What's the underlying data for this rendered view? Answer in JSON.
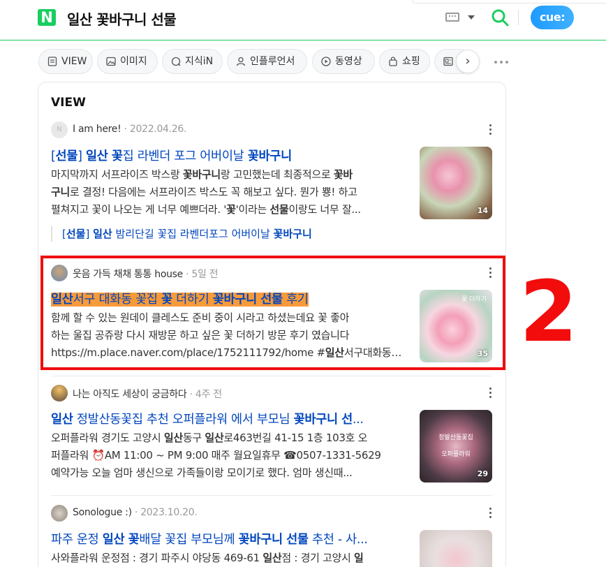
{
  "header": {
    "logo": "N",
    "query": "일산 꽃바구니 선물",
    "cue_label": "cue:"
  },
  "tabs": [
    {
      "label": "VIEW",
      "icon": "document-icon"
    },
    {
      "label": "이미지",
      "icon": "image-icon"
    },
    {
      "label": "지식iN",
      "icon": "question-icon"
    },
    {
      "label": "인플루언서",
      "icon": "person-icon"
    },
    {
      "label": "동영상",
      "icon": "play-icon"
    },
    {
      "label": "쇼핑",
      "icon": "bag-icon"
    },
    {
      "label": "",
      "icon": "news-icon"
    }
  ],
  "section_title": "VIEW",
  "results": [
    {
      "author": "I am here!",
      "date": "2022.04.26.",
      "title": "[선물] 일산 꽃집 라벤더 포그 어버이날 꽃바구니",
      "desc": [
        "마지막까지 서프라이즈 박스랑 꽃바구니랑 고민했는데 최종적으로 꽃바",
        "구니로 결정! 다음에는 서프라이즈 박스도 꼭 해보고 싶다. 뭔가 뿅! 하고",
        "펼쳐지고 꽃이 나오는 게 너무 예쁘더라. '꽃'이라는 선물이랑도 너무 잘..."
      ],
      "sub_link": "[선물] 일산 밤리단길 꽃집 라벤더포그 어버이날 꽃바구니",
      "thumb_count": "14"
    },
    {
      "author": "웃음 가득 채채 통통 house",
      "date": "5일 전",
      "title": "일산서구 대화동 꽃집 꽃 더하기 꽃바구니 선물 후기",
      "desc": [
        "함께 할 수 있는 원데이 클레스도 준비 중이 시라고 하셨는데요 꽃 좋아",
        "하는 울집 공쥬랑 다시 재방문 하고 싶은 꽃 더하기 방문 후기 였습니다",
        "https://m.place.naver.com/place/1752111792/home #일산서구대화동꽃..."
      ],
      "thumb_count": "35",
      "thumb_overlay": "꽃 더하기"
    },
    {
      "author": "나는 아직도 세상이 궁금하다",
      "date": "4주 전",
      "title": "일산 정발산동꽃집 추천 오퍼플라워 에서 부모님 꽃바구니 선...",
      "desc": [
        "오퍼플라워 경기도 고양시 일산동구 일산로463번길 41-15 1층 103호 오",
        "퍼플라워 ⏰AM 11:00 ~ PM 9:00 매주 월요일휴무 ☎0507-1331-5629",
        "예약가능 오늘 엄마 생신으로 가족들이랑 모이기로 했다. 엄마 생신때..."
      ],
      "thumb_count": "29",
      "thumb_overlay_1": "정발산동꽃집",
      "thumb_overlay_2": "오퍼플라워"
    },
    {
      "author": "Sonologue :)",
      "date": "2023.10.20.",
      "title": "파주 운정 일산 꽃배달 꽃집 부모님께 꽃바구니 선물 추천 - 사...",
      "desc": [
        "사와플라워 운정점 : 경기 파주시 야당동 469-61 일산점 : 경기 고양시 일"
      ]
    }
  ],
  "annotation": {
    "number": "2",
    "color": "#f00e0e"
  },
  "colors": {
    "brand_green": "#19ce60",
    "link_blue": "#0046be",
    "highlight_orange": "#f79a3a"
  }
}
